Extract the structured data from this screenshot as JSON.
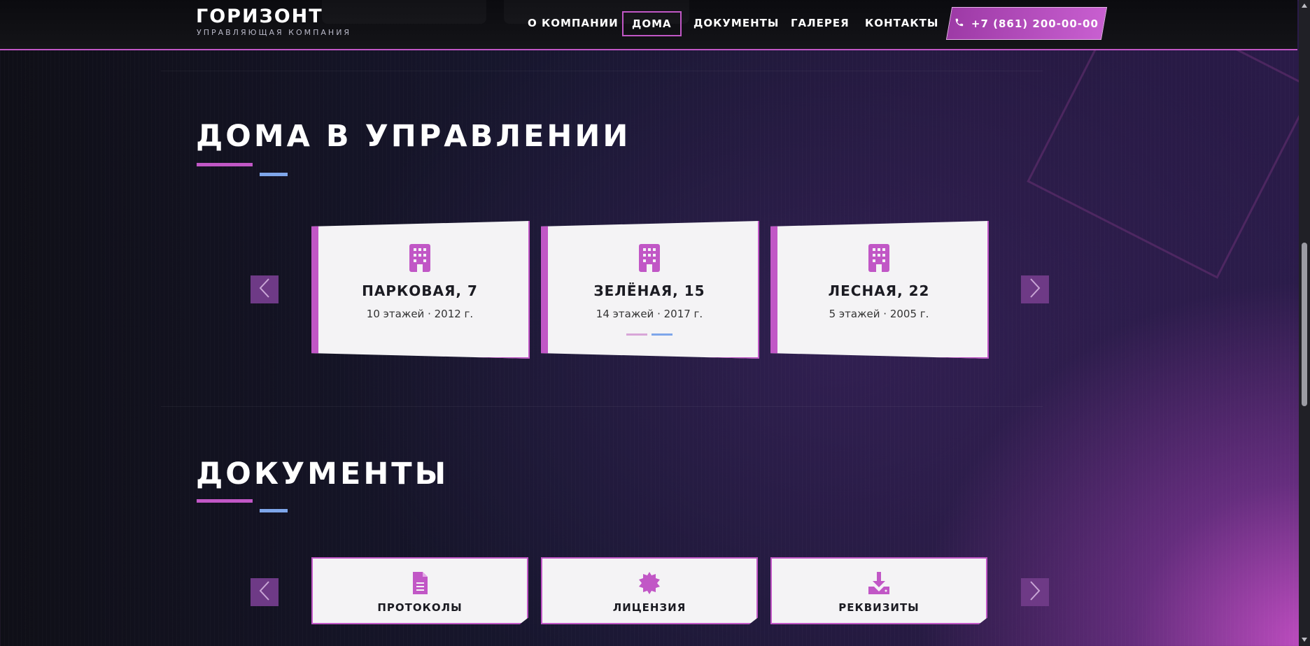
{
  "header": {
    "logo_title": "ГОРИЗОНТ",
    "logo_subtitle": "УПРАВЛЯЮЩАЯ КОМПАНИЯ",
    "nav": [
      {
        "label": "О КОМПАНИИ",
        "active": false
      },
      {
        "label": "ДОМА",
        "active": true
      },
      {
        "label": "ДОКУМЕНТЫ",
        "active": false
      },
      {
        "label": "ГАЛЕРЕЯ",
        "active": false
      },
      {
        "label": "КОНТАКТЫ",
        "active": false
      }
    ],
    "phone": "+7 (861) 200-00-00",
    "phone_icon": "phone-icon"
  },
  "houses": {
    "title": "ДОМА В УПРАВЛЕНИИ",
    "prev_icon": "chevron-left-icon",
    "next_icon": "chevron-right-icon",
    "items": [
      {
        "name": "ПАРКОВАЯ, 7",
        "info": "10 этажей · 2012 г.",
        "icon": "building-icon"
      },
      {
        "name": "ЗЕЛЁНАЯ, 15",
        "info": "14 этажей · 2017 г.",
        "icon": "building-icon"
      },
      {
        "name": "ЛЕСНАЯ, 22",
        "info": "5 этажей · 2005 г.",
        "icon": "building-icon"
      }
    ]
  },
  "documents": {
    "title": "ДОКУМЕНТЫ",
    "prev_icon": "chevron-left-icon",
    "next_icon": "chevron-right-icon",
    "items": [
      {
        "label": "ПРОТОКОЛЫ",
        "icon": "file-text-icon"
      },
      {
        "label": "ЛИЦЕНЗИЯ",
        "icon": "certificate-icon"
      },
      {
        "label": "РЕКВИЗИТЫ",
        "icon": "download-icon"
      }
    ]
  },
  "colors": {
    "accent": "#c157c6",
    "secondary": "#7ea6ea",
    "header_bg": "#0b0b0f",
    "arrow_bg": "#6e3a86"
  }
}
